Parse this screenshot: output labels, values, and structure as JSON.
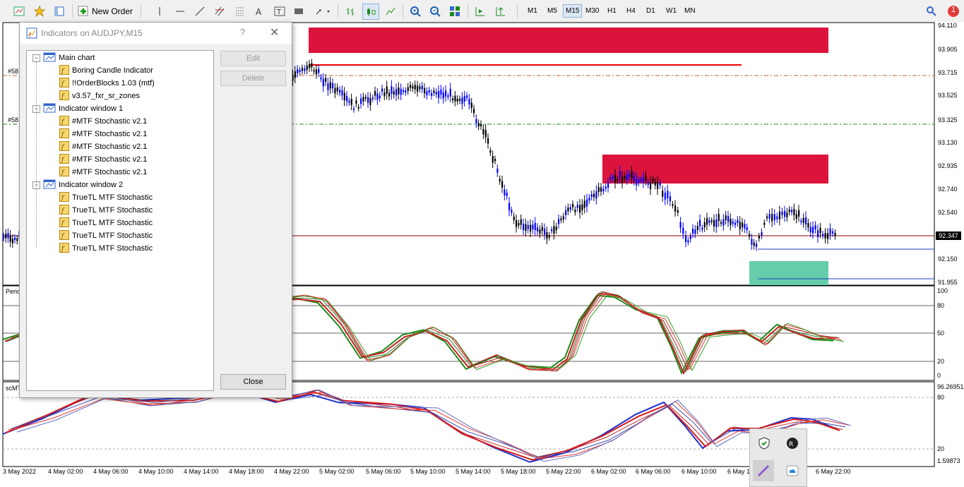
{
  "toolbar": {
    "new_order_label": "New Order",
    "timeframes": [
      "M1",
      "M5",
      "M15",
      "M30",
      "H1",
      "H4",
      "D1",
      "W1",
      "MN"
    ],
    "active_timeframe": "M15",
    "notification_count": "1"
  },
  "chart": {
    "price_ticks": [
      "94.110",
      "93.905",
      "93.715",
      "93.525",
      "93.325",
      "93.130",
      "92.935",
      "92.740",
      "92.540",
      "92.347",
      "92.150",
      "91.955"
    ],
    "current_price": "92.347",
    "time_ticks": [
      "3 May 2022",
      "4 May 02:00",
      "4 May 06:00",
      "4 May 10:00",
      "4 May 14:00",
      "4 May 18:00",
      "4 May 22:00",
      "5 May 02:00",
      "5 May 06:00",
      "5 May 10:00",
      "5 May 14:00",
      "5 May 18:00",
      "5 May 22:00",
      "6 May 02:00",
      "6 May 06:00",
      "6 May 10:00",
      "6 May 1",
      "6 May 22:00"
    ],
    "sub1_ticks": [
      "100",
      "80",
      "50",
      "20",
      "0"
    ],
    "sub2_ticks": [
      "96.26951",
      "80",
      "20",
      "1.59873"
    ],
    "left_labels": [
      "#58",
      "#58"
    ],
    "sub1_label": "Peric",
    "sub2_label": "scMT",
    "colors": {
      "supply_zone": "#dc143c",
      "demand_zone": "#66cdaa",
      "up_candle": "#0000ff",
      "down_candle": "#000000"
    }
  },
  "dialog": {
    "title": "Indicators on AUDJPY,M15",
    "help": "?",
    "close_x": "✕",
    "edit_label": "Edit",
    "delete_label": "Delete",
    "close_label": "Close",
    "groups": [
      {
        "name": "Main chart",
        "items": [
          "Boring Candle Indicator",
          "!!OrderBlocks 1.03 (mtf)",
          "v3.57_fxr_sr_zones"
        ]
      },
      {
        "name": "Indicator window 1",
        "items": [
          "#MTF Stochastic v2.1",
          "#MTF Stochastic v2.1",
          "#MTF Stochastic v2.1",
          "#MTF Stochastic v2.1",
          "#MTF Stochastic v2.1"
        ]
      },
      {
        "name": "Indicator window 2",
        "items": [
          "TrueTL MTF Stochastic",
          "TrueTL MTF Stochastic",
          "TrueTL MTF Stochastic",
          "TrueTL MTF Stochastic",
          "TrueTL MTF Stochastic"
        ]
      }
    ]
  }
}
